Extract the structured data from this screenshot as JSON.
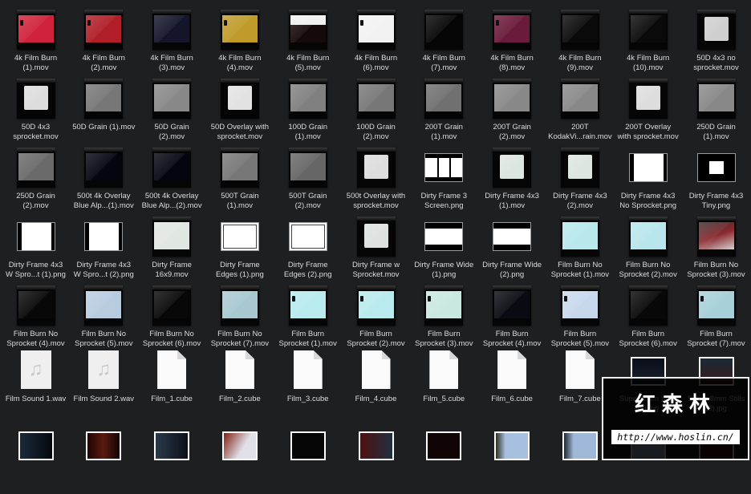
{
  "finder": {
    "items": [
      {
        "label": "4k Film Burn\n(1).mov",
        "kind": "mov",
        "color": "#d0223a",
        "spr": true
      },
      {
        "label": "4k Film Burn\n(2).mov",
        "kind": "mov",
        "color": "#b01e28",
        "spr": true
      },
      {
        "label": "4k Film Burn\n(3).mov",
        "kind": "mov",
        "color": "#14142a"
      },
      {
        "label": "4k Film Burn\n(4).mov",
        "kind": "mov",
        "color": "#c09a2a",
        "spr": true
      },
      {
        "label": "4k Film Burn\n(5).mov",
        "kind": "mov",
        "color": "linear-gradient(#f0f0f0 0 35%,#140a0a 36%)"
      },
      {
        "label": "4k Film Burn\n(6).mov",
        "kind": "mov",
        "color": "#f2f2f2",
        "spr": true
      },
      {
        "label": "4k Film Burn\n(7).mov",
        "kind": "mov",
        "color": "#050505"
      },
      {
        "label": "4k Film Burn\n(8).mov",
        "kind": "mov",
        "color": "#6a1a3a",
        "spr": true
      },
      {
        "label": "4k Film Burn\n(9).mov",
        "kind": "mov",
        "color": "#0a0a0a"
      },
      {
        "label": "4k Film Burn\n(10).mov",
        "kind": "mov",
        "color": "#0a0a0a"
      },
      {
        "label": "50D 4x3 no\nsprocket.mov",
        "kind": "mov",
        "color": "#cfcfcf",
        "small": true
      },
      {
        "label": "50D 4x3\nsprocket.mov",
        "kind": "mov",
        "color": "#dddddd",
        "small": true
      },
      {
        "label": "50D Grain (1).mov",
        "kind": "mov",
        "color": "#777777"
      },
      {
        "label": "50D Grain\n(2).mov",
        "kind": "mov",
        "color": "#888888"
      },
      {
        "label": "50D Overlay with\nsprocket.mov",
        "kind": "mov",
        "color": "#e2e2e2",
        "small": true
      },
      {
        "label": "100D Grain\n(1).mov",
        "kind": "mov",
        "color": "#808080"
      },
      {
        "label": "100D Grain\n(2).mov",
        "kind": "mov",
        "color": "#777777"
      },
      {
        "label": "200T Grain\n(1).mov",
        "kind": "mov",
        "color": "#707070"
      },
      {
        "label": "200T Grain\n(2).mov",
        "kind": "mov",
        "color": "#888888"
      },
      {
        "label": "200T\nKodakVi...rain.mov",
        "kind": "mov",
        "color": "#888888"
      },
      {
        "label": "200T Overlay\nwith sprocket.mov",
        "kind": "mov",
        "color": "#dddddd",
        "small": true
      },
      {
        "label": "250D Grain\n(1).mov",
        "kind": "mov",
        "color": "#888888"
      },
      {
        "label": "250D Grain\n(2).mov",
        "kind": "mov",
        "color": "#6a6a6a"
      },
      {
        "label": "500t 4k Overlay\nBlue Alp...(1).mov",
        "kind": "mov",
        "color": "#050510"
      },
      {
        "label": "500t 4k Overlay\nBlue Alp...(2).mov",
        "kind": "mov",
        "color": "#050510"
      },
      {
        "label": "500T Grain\n(1).mov",
        "kind": "mov",
        "color": "#777777"
      },
      {
        "label": "500T Grain\n(2).mov",
        "kind": "mov",
        "color": "#666666"
      },
      {
        "label": "500t Overlay with\nsprocket.mov",
        "kind": "mov",
        "color": "#dddddd",
        "small": true
      },
      {
        "label": "Dirty Frame 3\nScreen.png",
        "kind": "frame3"
      },
      {
        "label": "Dirty Frame 4x3\n(1).mov",
        "kind": "mov",
        "color": "#dde5e0",
        "small": true
      },
      {
        "label": "Dirty Frame 4x3\n(2).mov",
        "kind": "mov",
        "color": "#dde5e0",
        "small": true
      },
      {
        "label": "Dirty Frame 4x3\nNo Sprocket.png",
        "kind": "frameside"
      },
      {
        "label": "Dirty Frame 4x3\nTiny.png",
        "kind": "frametiny"
      },
      {
        "label": "Dirty Frame 4x3\nW Spro...t (1).png",
        "kind": "frameside"
      },
      {
        "label": "Dirty Frame 4x3\nW Spro...t (2).png",
        "kind": "frameside"
      },
      {
        "label": "Dirty Frame\n16x9.mov",
        "kind": "mov",
        "color": "#e0e6e2"
      },
      {
        "label": "Dirty Frame\nEdges (1).png",
        "kind": "frameedge"
      },
      {
        "label": "Dirty Frame\nEdges (2).png",
        "kind": "frameedge"
      },
      {
        "label": "Dirty Frame w\nSprocket.mov",
        "kind": "mov",
        "color": "#dde2e0",
        "small": true
      },
      {
        "label": "Dirty Frame Wide\n(1).png",
        "kind": "framewide"
      },
      {
        "label": "Dirty Frame Wide\n(2).png",
        "kind": "framewide"
      },
      {
        "label": "Film Burn No\nSprocket (1).mov",
        "kind": "mov",
        "color": "#b8e8ec"
      },
      {
        "label": "Film Burn No\nSprocket (2).mov",
        "kind": "mov",
        "color": "#b8e6ec"
      },
      {
        "label": "Film Burn No\nSprocket (3).mov",
        "kind": "mov",
        "color": "linear-gradient(160deg,#3a2a2a,#8a2a30 50%,#d8d0d0)"
      },
      {
        "label": "Film Burn No\nSprocket (4).mov",
        "kind": "mov",
        "color": "#080808"
      },
      {
        "label": "Film Burn No\nSprocket (5).mov",
        "kind": "mov",
        "color": "#b8cce0"
      },
      {
        "label": "Film Burn No\nSprocket (6).mov",
        "kind": "mov",
        "color": "#080808"
      },
      {
        "label": "Film Burn No\nSprocket (7).mov",
        "kind": "mov",
        "color": "#a8c8d0"
      },
      {
        "label": "Film Burn\nSprocket (1).mov",
        "kind": "mov",
        "color": "#b8eaee",
        "spr": true
      },
      {
        "label": "Film Burn\nSprocket (2).mov",
        "kind": "mov",
        "color": "#b8eaee",
        "spr": true
      },
      {
        "label": "Film Burn\nSprocket (3).mov",
        "kind": "mov",
        "color": "#c8e8e0",
        "spr": true
      },
      {
        "label": "Film Burn\nSprocket (4).mov",
        "kind": "mov",
        "color": "#0a0a12"
      },
      {
        "label": "Film Burn\nSprocket (5).mov",
        "kind": "mov",
        "color": "#c8d8ec",
        "spr": true
      },
      {
        "label": "Film Burn\nSprocket (6).mov",
        "kind": "mov",
        "color": "#080808"
      },
      {
        "label": "Film Burn\nSprocket (7).mov",
        "kind": "mov",
        "color": "#a8d0d8",
        "spr": true
      },
      {
        "label": "Film Sound 1.wav",
        "kind": "audio"
      },
      {
        "label": "Film Sound 2.wav",
        "kind": "audio"
      },
      {
        "label": "Film_1.cube",
        "kind": "doc"
      },
      {
        "label": "Film_2.cube",
        "kind": "doc"
      },
      {
        "label": "Film_3.cube",
        "kind": "doc"
      },
      {
        "label": "Film_4.cube",
        "kind": "doc"
      },
      {
        "label": "Film_5.cube",
        "kind": "doc"
      },
      {
        "label": "Film_6.cube",
        "kind": "doc"
      },
      {
        "label": "Film_7.cube",
        "kind": "doc"
      },
      {
        "label": "Super 8mm Stills\n(1).jpg",
        "kind": "img",
        "color": "linear-gradient(#0a0e18,#1a2030)"
      },
      {
        "label": "Super 8mm Stills\n(2).jpg",
        "kind": "img",
        "color": "linear-gradient(#1a2a38,#3a1a1a)"
      },
      {
        "label": "",
        "kind": "img",
        "color": "linear-gradient(90deg,#1a2a3a,#050810)"
      },
      {
        "label": "",
        "kind": "img",
        "color": "linear-gradient(90deg,#200505,#5a1a10 50%,#100505)"
      },
      {
        "label": "",
        "kind": "img",
        "color": "linear-gradient(90deg,#2a3a4a,#0a1018)"
      },
      {
        "label": "",
        "kind": "img",
        "color": "linear-gradient(120deg,#802010,#e0e0e8 60%)"
      },
      {
        "label": "",
        "kind": "img",
        "color": "#050505"
      },
      {
        "label": "",
        "kind": "img",
        "color": "linear-gradient(90deg,#501010,#203040)"
      },
      {
        "label": "",
        "kind": "img",
        "color": "#100404"
      },
      {
        "label": "",
        "kind": "img",
        "color": "linear-gradient(90deg,#303020,#a8c0e0 30%)"
      },
      {
        "label": "",
        "kind": "img",
        "color": "linear-gradient(90deg,#202830,#a0b8d8 30%)"
      },
      {
        "label": "",
        "kind": "img",
        "color": "#a0b8d8"
      },
      {
        "label": "",
        "kind": "img",
        "color": "#401010"
      }
    ]
  },
  "watermark": {
    "chinese": "红森林",
    "url": "http://www.hoslin.cn/"
  }
}
